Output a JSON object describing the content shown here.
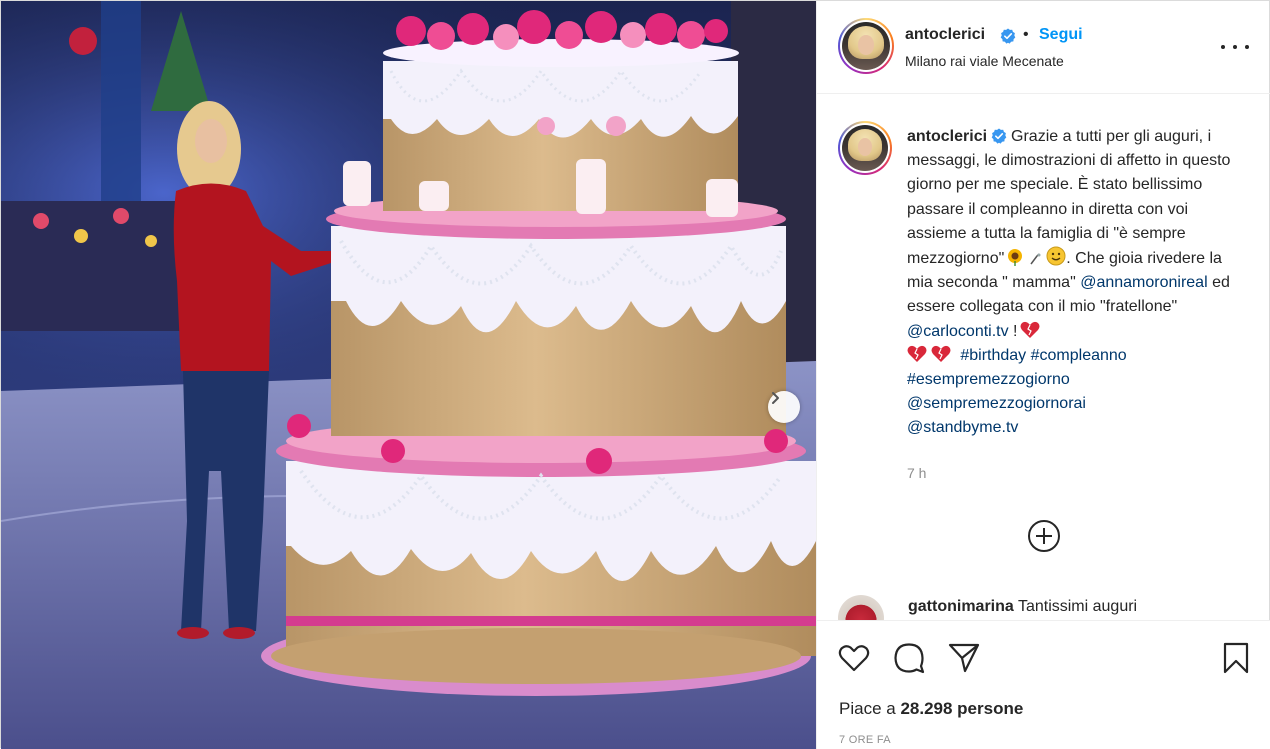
{
  "post": {
    "author": {
      "username": "antoclerici",
      "verified": true,
      "location": "Milano rai viale Mecenate",
      "follow_label": "Segui",
      "separator": "•"
    },
    "caption": {
      "username": "antoclerici",
      "text_1": "Grazie a tutti per gli auguri, i messaggi, le dimostrazioni di affetto in questo giorno per me speciale. È stato bellissimo passare il compleanno in diretta con voi assieme a tutta la famiglia di \"è sempre mezzogiorno\"",
      "text_2": ". Che gioia rivedere la mia seconda \" mamma\" ",
      "mention_1": "@annamoronireal",
      "text_3": " ed essere collegata con il mio \"fratellone\" ",
      "mention_2": "@carloconti.tv",
      "text_4": " !",
      "hashtag_1": "#birthday",
      "hashtag_2": "#compleanno",
      "hashtag_3": "#esempremezzogiorno",
      "mention_3": "@sempremezzogiornorai",
      "mention_4": "@standbyme.tv",
      "time_ago": "7 h"
    },
    "comment": {
      "username": "gattonimarina",
      "text": "Tantissimi auguri"
    },
    "likes": {
      "prefix": "Piace a ",
      "count": "28.298 persone"
    },
    "posted_label": "7 ORE FA",
    "icons": {
      "verified": "verified-badge-icon",
      "more": "more-options-icon",
      "next": "chevron-right-icon",
      "load_more": "plus-circle-icon",
      "like": "heart-icon",
      "comment": "comment-bubble-icon",
      "share": "paper-plane-icon",
      "save": "bookmark-icon"
    },
    "colors": {
      "link": "#00376b",
      "follow": "#0095f6",
      "verified": "#3897f0",
      "muted": "#8e8e8e"
    }
  }
}
